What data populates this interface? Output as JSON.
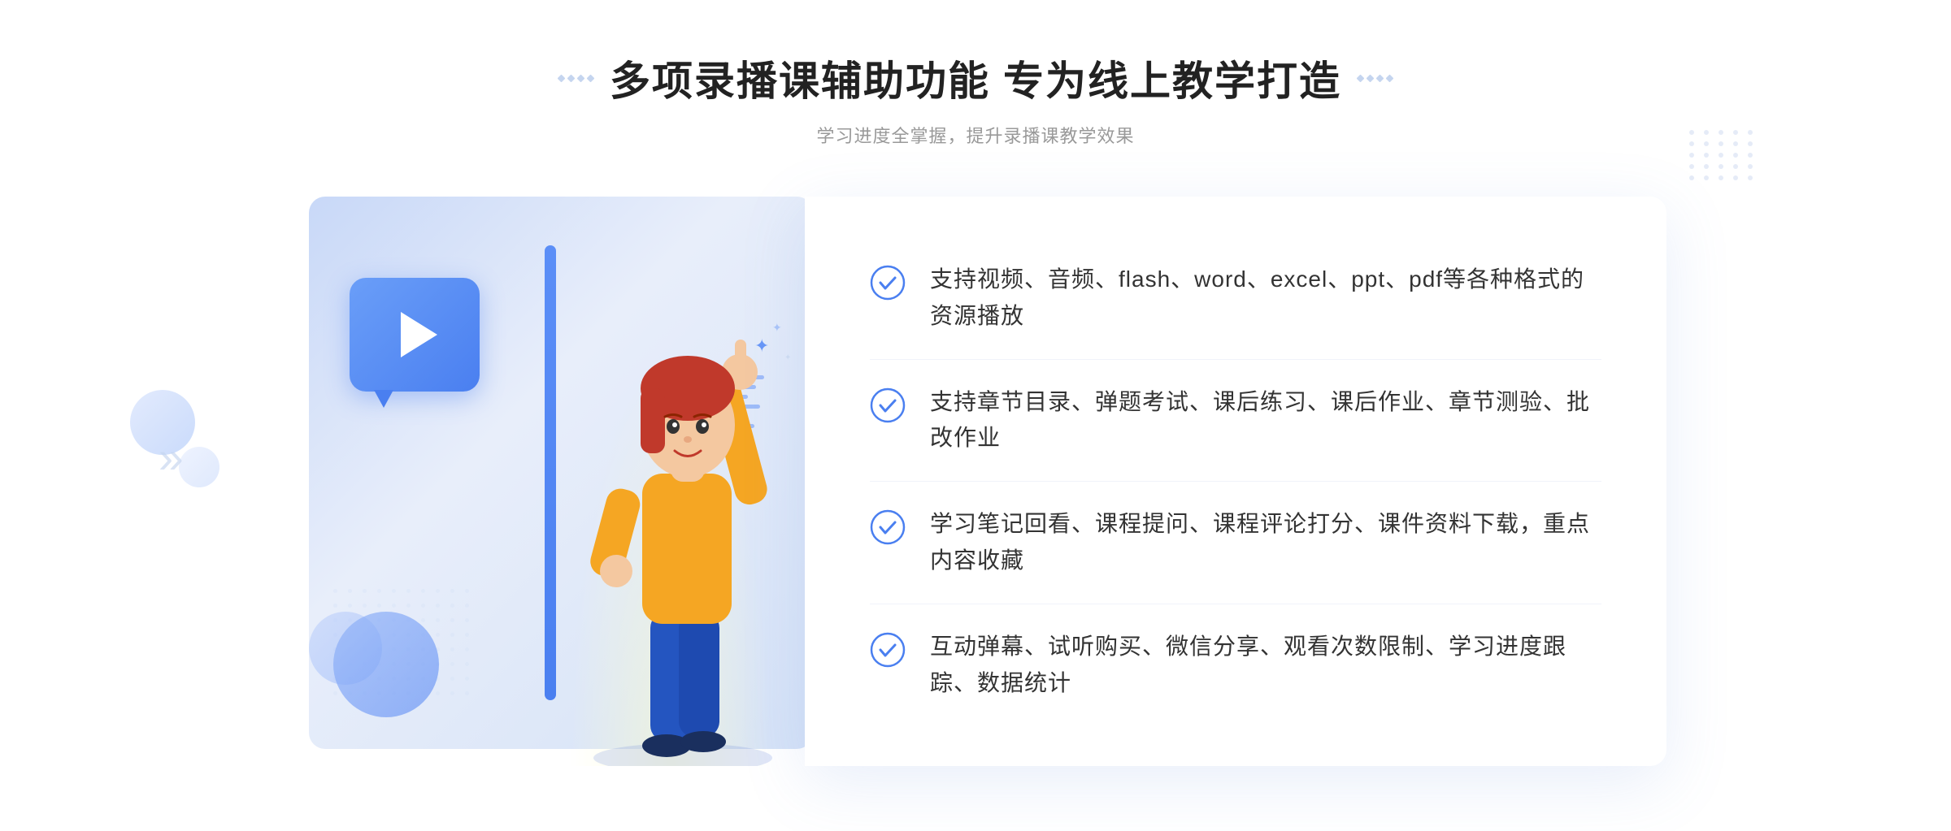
{
  "page": {
    "title": "多项录播课辅助功能 专为线上教学打造",
    "subtitle": "学习进度全掌握，提升录播课教学效果",
    "colors": {
      "accent": "#4a7ff0",
      "light_blue": "#c8d8f8",
      "text_dark": "#222222",
      "text_gray": "#999999",
      "text_body": "#333333"
    }
  },
  "features": [
    {
      "id": 1,
      "text": "支持视频、音频、flash、word、excel、ppt、pdf等各种格式的资源播放"
    },
    {
      "id": 2,
      "text": "支持章节目录、弹题考试、课后练习、课后作业、章节测验、批改作业"
    },
    {
      "id": 3,
      "text": "学习笔记回看、课程提问、课程评论打分、课件资料下载，重点内容收藏"
    },
    {
      "id": 4,
      "text": "互动弹幕、试听购买、微信分享、观看次数限制、学习进度跟踪、数据统计"
    }
  ],
  "decorations": {
    "chevron": "»",
    "play_label": "play-button"
  }
}
